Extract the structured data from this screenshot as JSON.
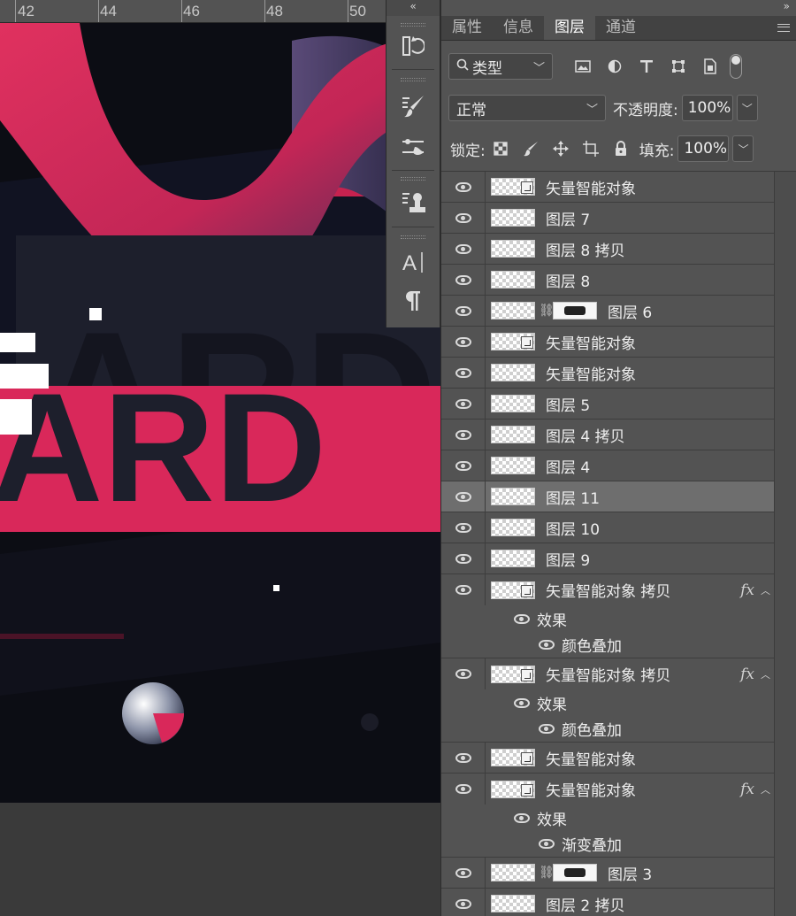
{
  "ruler": {
    "marks": [
      "42",
      "44",
      "46",
      "48",
      "50"
    ]
  },
  "toolstrip": {
    "collapse": "«",
    "tools": [
      "history-icon",
      "brush-presets-icon",
      "brush-settings-icon",
      "clone-source-icon",
      "character-icon",
      "paragraph-icon"
    ]
  },
  "panel": {
    "collapse": "»",
    "tabs": [
      "属性",
      "信息",
      "图层",
      "通道"
    ],
    "active_tab": "图层",
    "filter": {
      "kind": "类型"
    },
    "blend_mode": "正常",
    "opacity_label": "不透明度:",
    "opacity_value": "100%",
    "lock_label": "锁定:",
    "fill_label": "填充:",
    "fill_value": "100%"
  },
  "layers": [
    {
      "name": "矢量智能对象",
      "smart": true
    },
    {
      "name": "图层 7"
    },
    {
      "name": "图层 8 拷贝"
    },
    {
      "name": "图层 8"
    },
    {
      "name": "图层 6",
      "mask": true
    },
    {
      "name": "矢量智能对象",
      "smart": true
    },
    {
      "name": "矢量智能对象"
    },
    {
      "name": "图层 5"
    },
    {
      "name": "图层 4 拷贝"
    },
    {
      "name": "图层 4"
    },
    {
      "name": "图层 11",
      "selected": true
    },
    {
      "name": "图层 10"
    },
    {
      "name": "图层 9"
    },
    {
      "name": "矢量智能对象 拷贝",
      "smart": true,
      "fx": "fx",
      "effects_label": "效果",
      "effect": "颜色叠加"
    },
    {
      "name": "矢量智能对象 拷贝",
      "smart": true,
      "fx": "fx",
      "effects_label": "效果",
      "effect": "颜色叠加"
    },
    {
      "name": "矢量智能对象",
      "smart": true
    },
    {
      "name": "矢量智能对象",
      "smart": true,
      "fx": "fx",
      "effects_label": "效果",
      "effect": "渐变叠加"
    },
    {
      "name": "图层 3",
      "mask": true
    },
    {
      "name": "图层 2 拷贝"
    }
  ],
  "colors": {
    "accent_red": "#d9285a",
    "canvas_bg": "#0c0d14",
    "panel_bg": "#535353"
  }
}
